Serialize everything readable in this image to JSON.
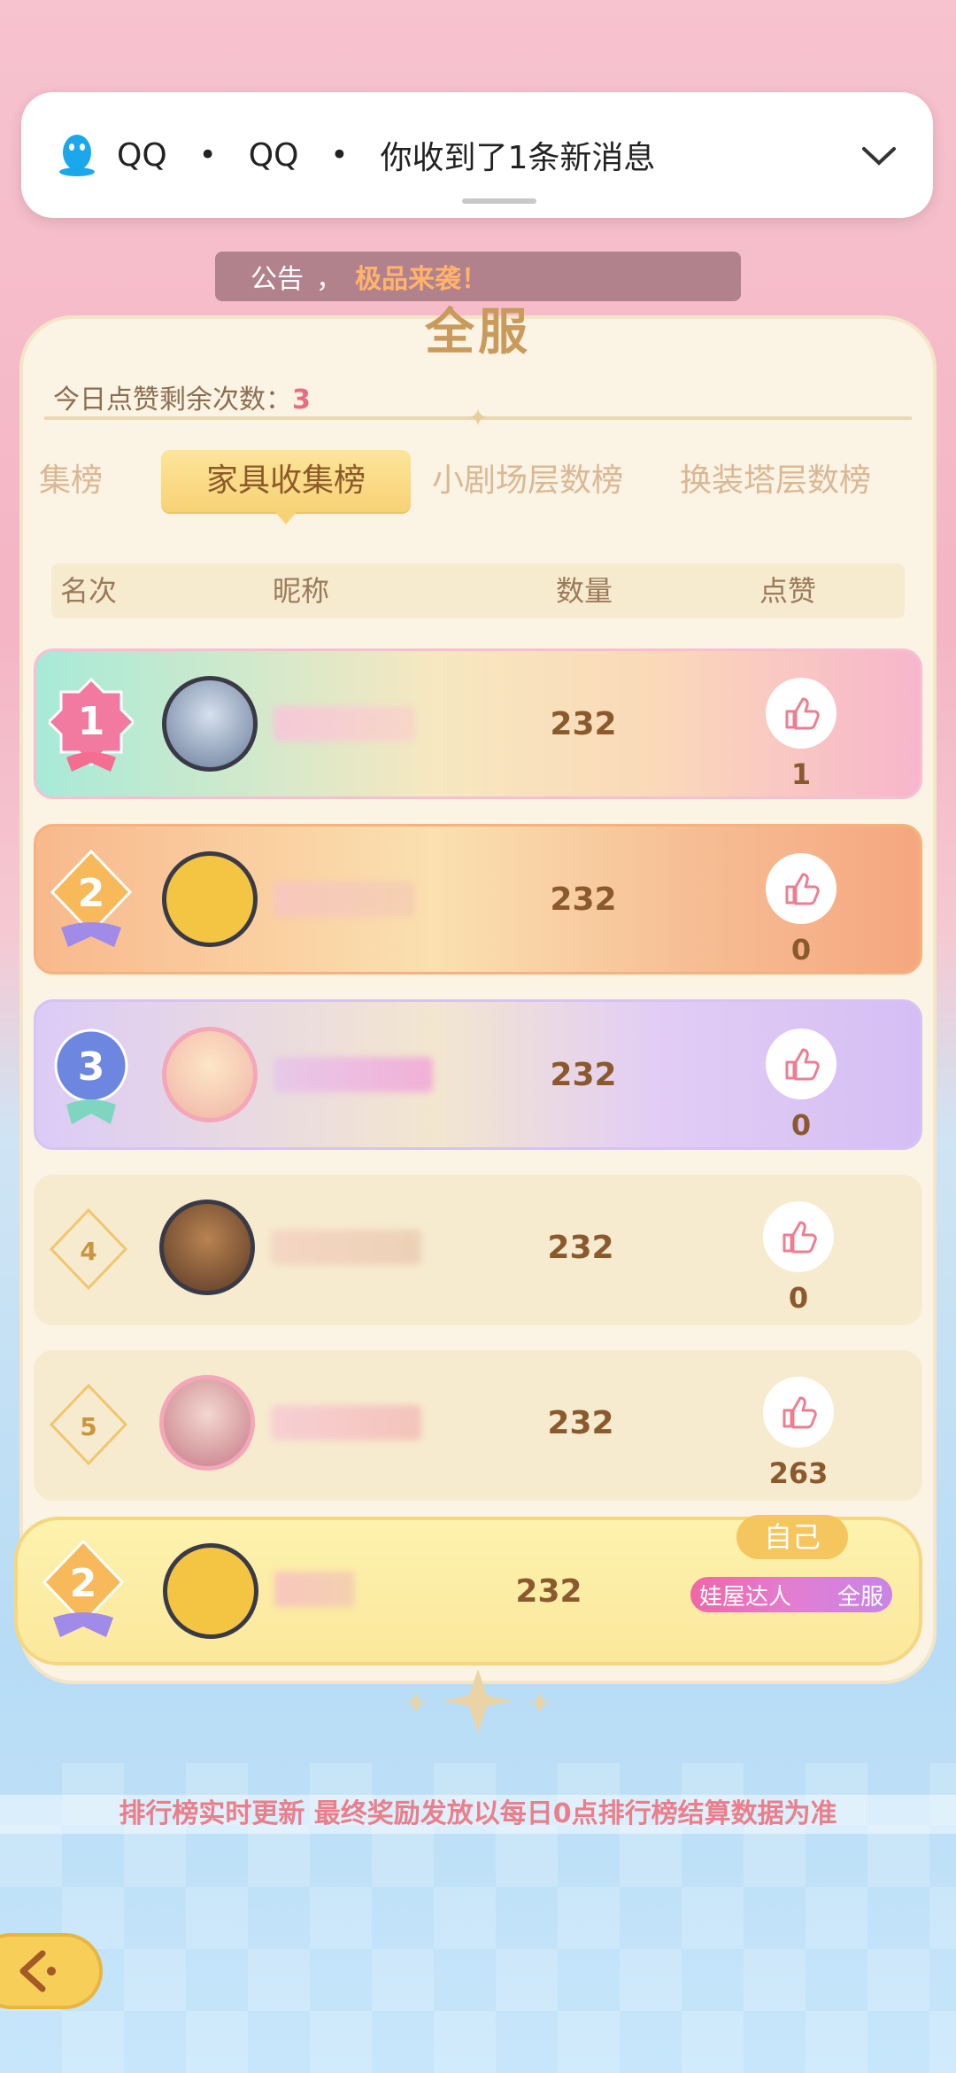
{
  "notification": {
    "app": "QQ",
    "source": "QQ",
    "dot": "•",
    "message": "你收到了1条新消息"
  },
  "announcement": {
    "label": "公告",
    "separator": "，",
    "highlight": "极品来袭！"
  },
  "panel": {
    "title": "全服",
    "likes_remaining_label": "今日点赞剩余次数：",
    "likes_remaining_value": "3"
  },
  "tabs": [
    {
      "label": "集榜",
      "active": false
    },
    {
      "label": "家具收集榜",
      "active": true
    },
    {
      "label": "小剧场层数榜",
      "active": false
    },
    {
      "label": "换装塔层数榜",
      "active": false
    }
  ],
  "table_header": {
    "rank": "名次",
    "nickname": "昵称",
    "quantity": "数量",
    "likes": "点赞"
  },
  "rows": [
    {
      "rank": "1",
      "quantity": "232",
      "likes": "1"
    },
    {
      "rank": "2",
      "quantity": "232",
      "likes": "0"
    },
    {
      "rank": "3",
      "quantity": "232",
      "likes": "0"
    },
    {
      "rank": "4",
      "quantity": "232",
      "likes": "0"
    },
    {
      "rank": "5",
      "quantity": "232",
      "likes": "263"
    }
  ],
  "self_row": {
    "rank": "2",
    "quantity": "232",
    "tag": "自己",
    "title_left": "娃屋达人",
    "title_right": "全服"
  },
  "bottom_note": "排行榜实时更新 最终奖励发放以每日0点排行榜结算数据为准",
  "colors": {
    "accent_gold": "#f8d276",
    "like_pink": "#ea6b82",
    "text_brown": "#8a5a2e"
  }
}
